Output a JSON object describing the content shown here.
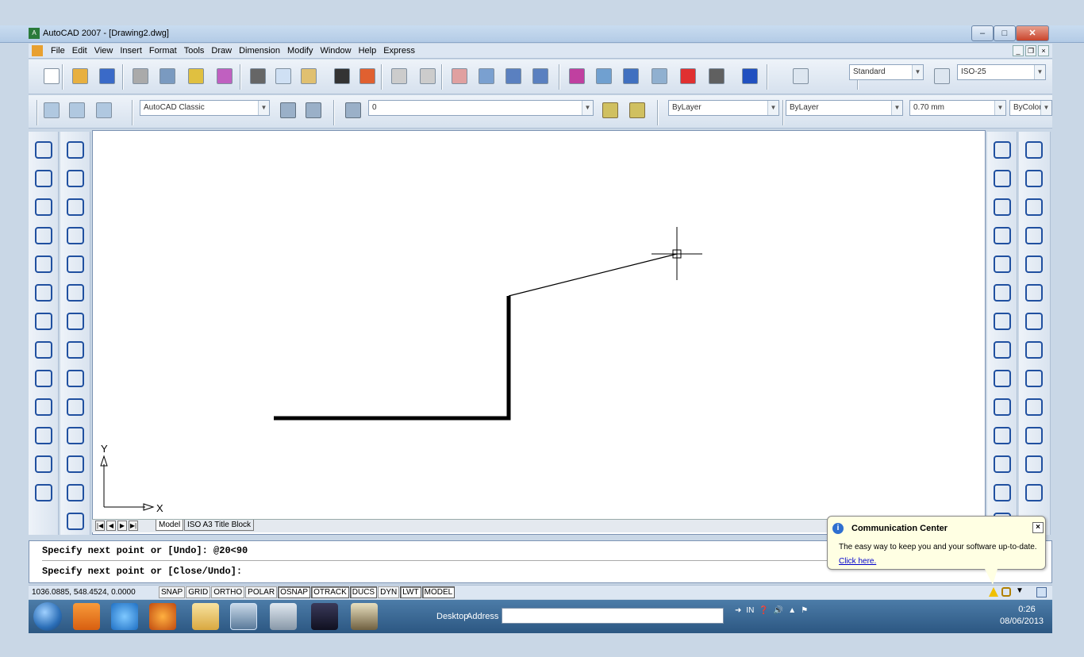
{
  "window": {
    "title": "AutoCAD 2007 - [Drawing2.dwg]",
    "app_icon_label": "A"
  },
  "menu": {
    "items": [
      "File",
      "Edit",
      "View",
      "Insert",
      "Format",
      "Tools",
      "Draw",
      "Dimension",
      "Modify",
      "Window",
      "Help",
      "Express"
    ]
  },
  "toolbar1": {
    "text_style": "Standard",
    "dim_style": "ISO-25"
  },
  "toolbar2": {
    "workspace": "AutoCAD Classic",
    "layer": "0",
    "color": "ByLayer",
    "linetype": "ByLayer",
    "lineweight": "0.70 mm",
    "plot_style": "ByColor"
  },
  "canvas": {
    "ucs_x": "X",
    "ucs_y": "Y"
  },
  "tabs": {
    "model": "Model",
    "layout": "ISO A3 Title Block"
  },
  "command": {
    "line1": "Specify next point or [Undo]: @20<90",
    "line2": "Specify next point or [Close/Undo]:"
  },
  "status": {
    "coords": "1036.0885, 548.4524, 0.0000",
    "buttons": [
      {
        "label": "SNAP",
        "on": false
      },
      {
        "label": "GRID",
        "on": false
      },
      {
        "label": "ORTHO",
        "on": false
      },
      {
        "label": "POLAR",
        "on": false
      },
      {
        "label": "OSNAP",
        "on": true
      },
      {
        "label": "OTRACK",
        "on": true
      },
      {
        "label": "DUCS",
        "on": true
      },
      {
        "label": "DYN",
        "on": false
      },
      {
        "label": "LWT",
        "on": true
      },
      {
        "label": "MODEL",
        "on": true
      }
    ]
  },
  "popup": {
    "title": "Communication Center",
    "body": "The easy way to keep you and your software up-to-date.",
    "link": "Click here."
  },
  "taskbar": {
    "desktop": "Desktop",
    "address": "Address",
    "time": "0:26",
    "date": "08/06/2013",
    "tray_lang": "IN"
  }
}
